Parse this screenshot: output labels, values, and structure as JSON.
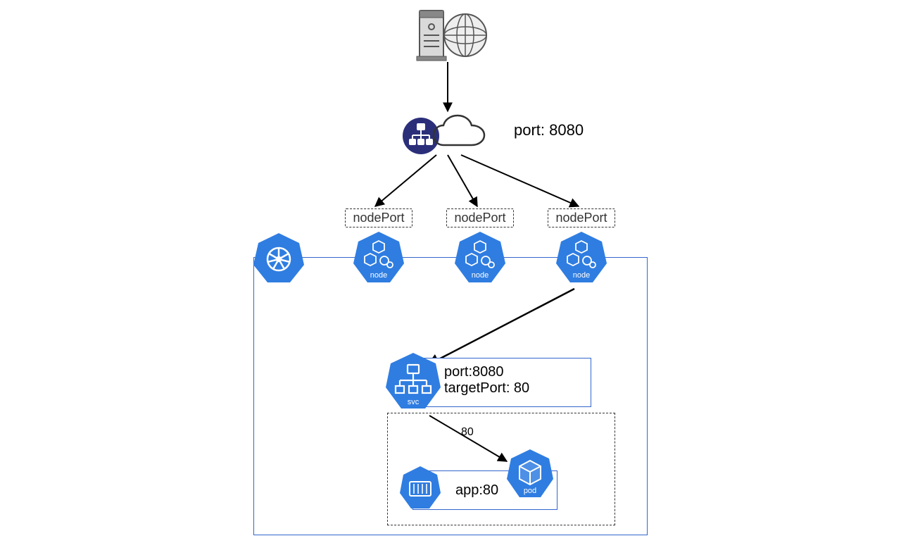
{
  "loadbalancer": {
    "port_label": "port: 8080"
  },
  "nodes": [
    {
      "nodeport_label": "nodePort",
      "icon_label": "node"
    },
    {
      "nodeport_label": "nodePort",
      "icon_label": "node"
    },
    {
      "nodeport_label": "nodePort",
      "icon_label": "node"
    }
  ],
  "service": {
    "icon_label": "svc",
    "port_label": "port:8080",
    "target_port_label": "targetPort: 80"
  },
  "edge_svc_to_pod_label": "80",
  "pod": {
    "icon_label": "pod",
    "app_label": "app:80"
  }
}
